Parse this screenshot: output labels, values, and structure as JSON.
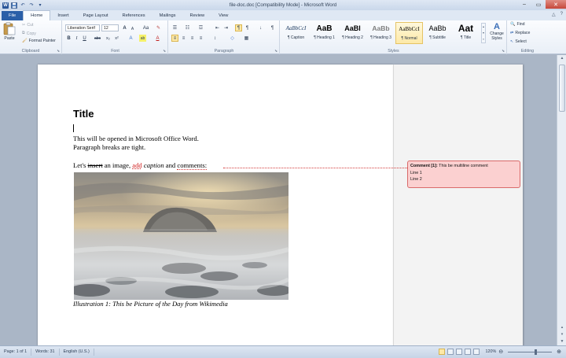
{
  "window": {
    "title": "file-doc.doc [Compatibility Mode] - Microsoft Word",
    "controls": {
      "minimize": "–",
      "maximize": "▭",
      "close": "✕"
    }
  },
  "qat": [
    "W",
    "💾",
    "↶",
    "↷",
    "▾"
  ],
  "tabs": [
    "File",
    "Home",
    "Insert",
    "Page Layout",
    "References",
    "Mailings",
    "Review",
    "View"
  ],
  "active_tab": "Home",
  "tabs_right": {
    "minimize_ribbon": "△",
    "help": "?"
  },
  "ribbon": {
    "clipboard": {
      "label": "Clipboard",
      "paste": "Paste",
      "cut": "Cut",
      "copy": "Copy",
      "format_painter": "Format Painter"
    },
    "font": {
      "label": "Font",
      "font_name": "Liberation Serif",
      "font_size": "12",
      "grow": "A",
      "shrink": "A",
      "change_case": "Aa",
      "clear": "✎",
      "bold": "B",
      "italic": "I",
      "underline": "U",
      "strike": "abc",
      "sub": "x₂",
      "sup": "x²",
      "effects": "A",
      "highlight": "ab",
      "color": "A"
    },
    "paragraph": {
      "label": "Paragraph",
      "bullets": "☰",
      "numbering": "☷",
      "multilevel": "☲",
      "decrease_indent": "⇤",
      "increase_indent": "⇥",
      "ltr": "¶",
      "rtl": "¶",
      "sort": "↓",
      "show_marks": "¶",
      "align_left": "≡",
      "align_center": "≡",
      "align_right": "≡",
      "justify": "≡",
      "line_spacing": "↕",
      "shading": "◇",
      "borders": "▦"
    },
    "styles": {
      "label": "Styles",
      "items": [
        {
          "sample": "AaBbCcI",
          "name": "¶ Caption"
        },
        {
          "sample": "AaB",
          "name": "¶ Heading 1"
        },
        {
          "sample": "AaBl",
          "name": "¶ Heading 2"
        },
        {
          "sample": "AaBb",
          "name": "¶ Heading 3"
        },
        {
          "sample": "AaBbCcI",
          "name": "¶ Normal"
        },
        {
          "sample": "AaBb",
          "name": "¶ Subtitle"
        },
        {
          "sample": "Aat",
          "name": "¶ Title"
        }
      ],
      "selected": "¶ Normal",
      "change_styles": "Change Styles"
    },
    "editing": {
      "label": "Editing",
      "find": "Find",
      "replace": "Replace",
      "select": "Select"
    }
  },
  "document": {
    "title": "Title",
    "line1": "This will be opened in Microsoft Office Word.",
    "line2": "Paragraph breaks are tight.",
    "p3": {
      "before": "Let's ",
      "deleted": "insert",
      "middle": " an image, ",
      "inserted": "add",
      "space1": " ",
      "italic": "caption",
      "and": " and ",
      "commented": "comments:"
    },
    "caption": "Illustration 1: This be Picture of the Day from Wikimedia"
  },
  "comment": {
    "label": "Comment [1]:",
    "text": " This be multiline comment",
    "line1": "Line 1",
    "line2": "Line 2"
  },
  "status": {
    "page": "Page: 1 of 1",
    "words": "Words: 31",
    "language": "English (U.S.)",
    "zoom": "120%"
  },
  "colors": {
    "comment_fill": "#fbd0d0",
    "comment_border": "#d96a6a",
    "file_tab": "#2a5fa8"
  }
}
